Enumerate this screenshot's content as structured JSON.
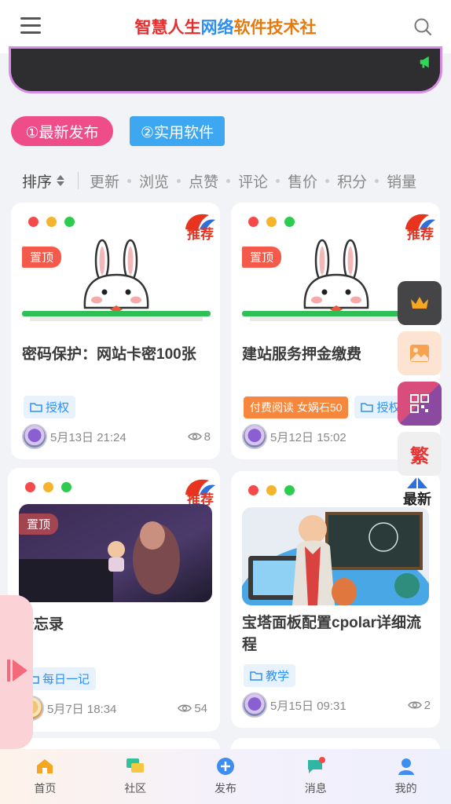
{
  "header": {
    "title_part1": "智慧人生",
    "title_part2": "网络",
    "title_part3": "软件技术社"
  },
  "pills": {
    "latest": "①最新发布",
    "useful": "②实用软件"
  },
  "sort": {
    "label": "排序",
    "items": [
      "更新",
      "浏览",
      "点赞",
      "评论",
      "售价",
      "积分",
      "销量"
    ]
  },
  "badges": {
    "recommend": "推荐",
    "pinned": "置顶"
  },
  "cards": [
    {
      "title": "密码保护：网站卡密100张",
      "tag": "授权",
      "date": "5月13日 21:24",
      "views": "8"
    },
    {
      "title": "建站服务押金缴费",
      "paid_label": "付费阅读 女娲石50",
      "tag": "授权",
      "date": "5月12日 15:02",
      "views": ""
    },
    {
      "title": "备忘录",
      "tag": "每日一记",
      "date": "5月7日 18:34",
      "views": "54"
    },
    {
      "title": "宝塔面板配置cpolar详细流程",
      "tag": "教学",
      "date": "5月15日 09:31",
      "views": "2"
    }
  ],
  "float_buttons": {
    "traditional": "繁",
    "newest": "最新"
  },
  "tabbar": [
    {
      "label": "首页",
      "icon": "home-icon",
      "color": "#f5a623"
    },
    {
      "label": "社区",
      "icon": "chat-icon",
      "color": "#33c19a"
    },
    {
      "label": "发布",
      "icon": "plus-circle-icon",
      "color": "#3e8ef0"
    },
    {
      "label": "消息",
      "icon": "message-icon",
      "color": "#2fb7a3"
    },
    {
      "label": "我的",
      "icon": "user-icon",
      "color": "#3e8ef0"
    }
  ],
  "colors": {
    "pill_pink": "#ef4d8a",
    "pill_blue": "#3ea7f2",
    "accent_red": "#e8331f",
    "tag_blue": "#2f8ff0",
    "paid_orange": "#f7873c"
  }
}
